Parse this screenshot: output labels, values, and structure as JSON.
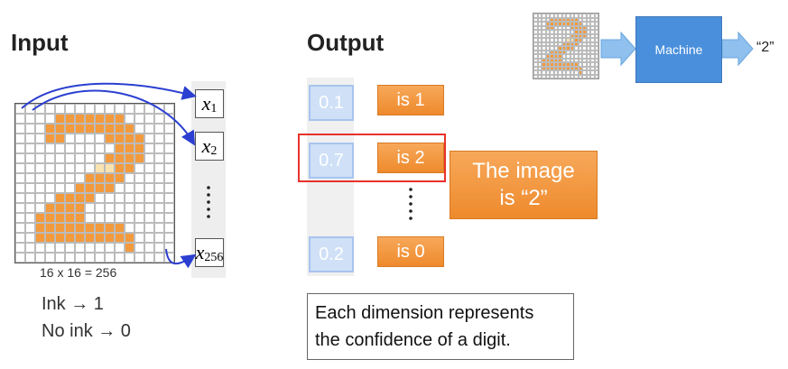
{
  "input_heading": "Input",
  "output_heading": "Output",
  "grid_caption": "16 x 16 = 256",
  "ink_rule": "Ink → 1",
  "no_ink_rule": "No ink → 0",
  "inputs": {
    "x1": "x",
    "x1_sub": "1",
    "x2": "x",
    "x2_sub": "2",
    "x256": "x",
    "x256_sub": "256"
  },
  "outputs": [
    {
      "value": "0.1",
      "label": "is 1"
    },
    {
      "value": "0.7",
      "label": "is 2"
    },
    {
      "value": "0.2",
      "label": "is 0"
    }
  ],
  "result_line1": "The image",
  "result_line2": "is “2”",
  "explanation_line1": "Each dimension represents",
  "explanation_line2": "the confidence of a digit.",
  "machine_label": "Machine",
  "machine_output": "“2”",
  "colors": {
    "ink": "#f39a3c",
    "faint": "#fbe3b0",
    "highlight": "#e8322a",
    "machine": "#4a8fdc",
    "arrow": "#8fc0ee"
  }
}
